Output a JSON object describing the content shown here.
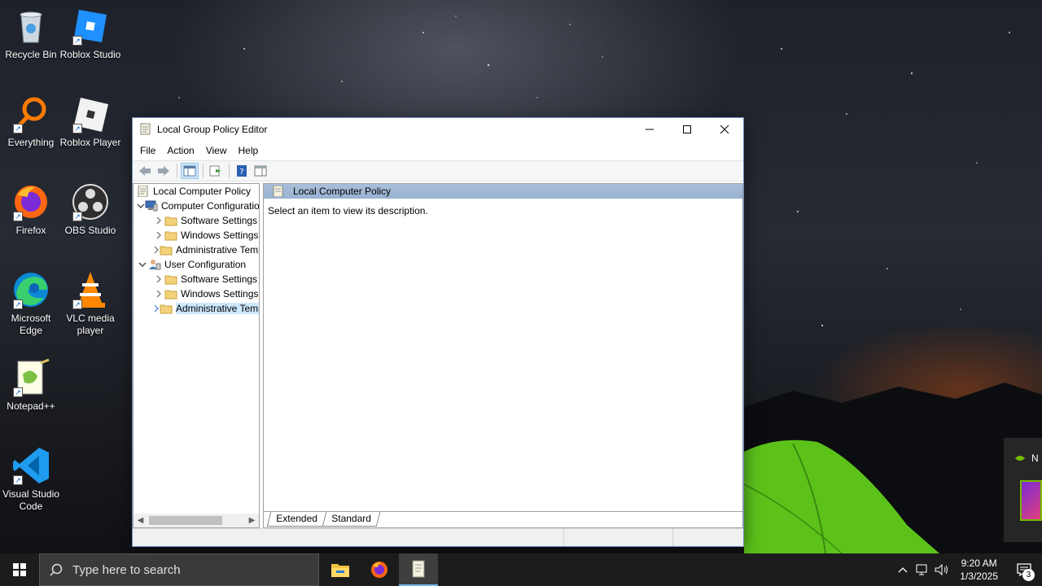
{
  "desktop": {
    "icons": [
      {
        "label": "Recycle Bin",
        "icon": "recycle-bin-icon"
      },
      {
        "label": "Roblox Studio",
        "icon": "roblox-studio-icon"
      },
      {
        "label": "Everything",
        "icon": "everything-search-icon"
      },
      {
        "label": "Roblox Player",
        "icon": "roblox-player-icon"
      },
      {
        "label": "Firefox",
        "icon": "firefox-icon"
      },
      {
        "label": "OBS Studio",
        "icon": "obs-icon"
      },
      {
        "label": "Microsoft Edge",
        "icon": "edge-icon"
      },
      {
        "label": "VLC media player",
        "icon": "vlc-icon"
      },
      {
        "label": "Notepad++",
        "icon": "notepadpp-icon"
      },
      {
        "label": "Visual Studio Code",
        "icon": "vscode-icon"
      }
    ]
  },
  "window": {
    "title": "Local Group Policy Editor",
    "menu": [
      "File",
      "Action",
      "View",
      "Help"
    ],
    "tree": [
      {
        "label": "Local Computer Policy",
        "level": 0,
        "expander": "",
        "icon": "policy-doc-icon"
      },
      {
        "label": "Computer Configuration",
        "level": 1,
        "expander": "⌄",
        "icon": "computer-icon"
      },
      {
        "label": "Software Settings",
        "level": 2,
        "expander": "›",
        "icon": "folder-icon"
      },
      {
        "label": "Windows Settings",
        "level": 2,
        "expander": "›",
        "icon": "folder-icon"
      },
      {
        "label": "Administrative Templates",
        "level": 2,
        "expander": "›",
        "icon": "folder-icon"
      },
      {
        "label": "User Configuration",
        "level": 1,
        "expander": "⌄",
        "icon": "user-icon"
      },
      {
        "label": "Software Settings",
        "level": 2,
        "expander": "›",
        "icon": "folder-icon"
      },
      {
        "label": "Windows Settings",
        "level": 2,
        "expander": "›",
        "icon": "folder-icon"
      },
      {
        "label": "Administrative Templates",
        "level": 2,
        "expander": "›",
        "icon": "folder-icon",
        "selected": true
      }
    ],
    "detail": {
      "header": "Local Computer Policy",
      "description": "Select an item to view its description."
    },
    "tabs": [
      "Extended",
      "Standard"
    ]
  },
  "taskbar": {
    "search_placeholder": "Type here to search",
    "time": "9:20 AM",
    "date": "1/3/2025",
    "notification_count": "3"
  },
  "toast": {
    "text": "N"
  },
  "colors": {
    "accent": "#0078d7",
    "selection": "#cce8ff",
    "detail_header": "#a9bfd9",
    "taskbar": "#1c1c1c"
  }
}
